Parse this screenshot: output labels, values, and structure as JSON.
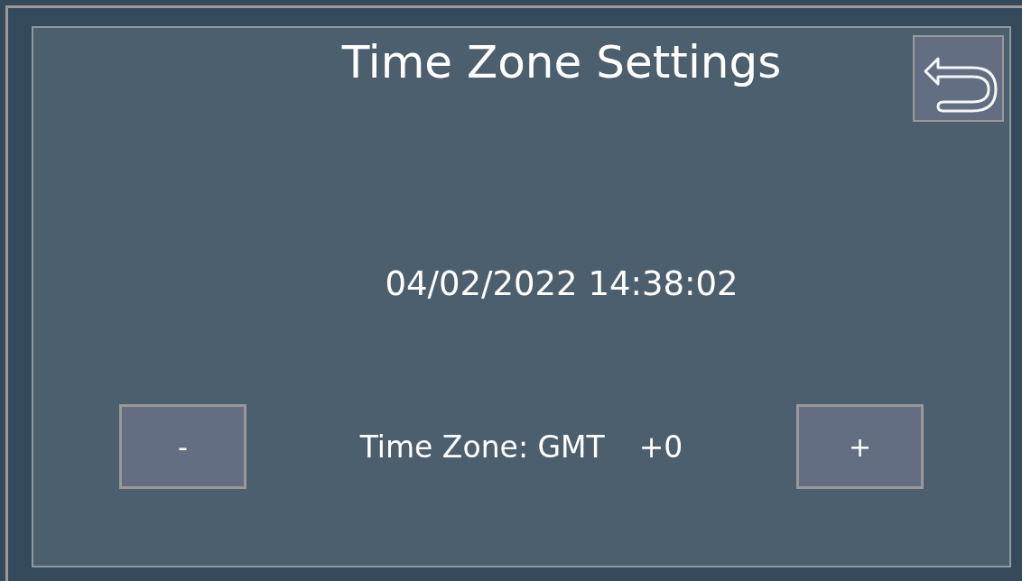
{
  "title": "Time Zone Settings",
  "datetime": "04/02/2022 14:38:02",
  "time_zone": {
    "label": "Time Zone: GMT",
    "offset": "+0"
  },
  "buttons": [
    {
      "label": "-",
      "kind": "decrease"
    },
    {
      "label": "+",
      "kind": "increase"
    }
  ]
}
